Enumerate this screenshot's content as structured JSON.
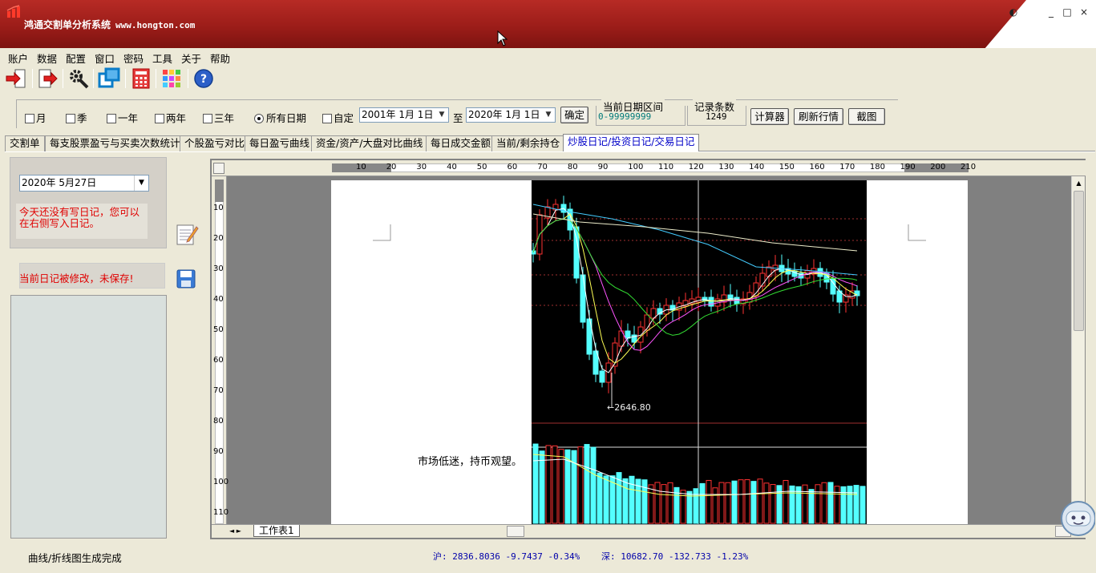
{
  "window": {
    "title": "鸿通交割单分析系统",
    "site": "www.hongton.com",
    "controls": [
      "◐",
      "_",
      "□",
      "×"
    ]
  },
  "menu": [
    "账户",
    "数据",
    "配置",
    "窗口",
    "密码",
    "工具",
    "关于",
    "帮助"
  ],
  "toolbar": [
    "login-icon",
    "logout-icon",
    "settings-tools-icon",
    "windows-icon",
    "calculator-icon",
    "color-grid-icon",
    "help-icon"
  ],
  "filters": {
    "options": [
      "月",
      "季",
      "一年",
      "两年",
      "三年"
    ],
    "all_dates": "所有日期",
    "custom": "自定",
    "from_date": "2001年 1月 1日",
    "to_label": "至",
    "to_date": "2020年 1月 1日",
    "confirm": "确定",
    "range_label": "当前日期区间",
    "range_value": "0-99999999",
    "count_label": "记录条数",
    "count_value": "1249",
    "calc_button": "计算器",
    "refresh_button": "刷新行情",
    "screenshot_button": "截图"
  },
  "tabs": [
    "交割单",
    "每支股票盈亏与买卖次数统计",
    "个股盈亏对比",
    "每日盈亏曲线",
    "资金/资产/大盘对比曲线",
    "每日成交金额",
    "当前/剩余持仓",
    "炒股日记/投资日记/交易日记"
  ],
  "active_tab": 7,
  "diary": {
    "date": "2020年 5月27日",
    "notice": "今天还没有写日记，您可以在右侧写入日记。",
    "unsaved": "当前日记被修改，未保存!"
  },
  "editor": {
    "hruler": [
      "10",
      "20",
      "30",
      "40",
      "50",
      "60",
      "70",
      "80",
      "90",
      "100",
      "110",
      "120",
      "130",
      "140",
      "150",
      "160",
      "170",
      "180",
      "190",
      "200",
      "210"
    ],
    "vruler": [
      "10",
      "20",
      "30",
      "40",
      "50",
      "60",
      "70",
      "80",
      "90",
      "100",
      "110"
    ],
    "note": "市场低迷，持币观望。",
    "low_label": "←2646.80",
    "sheet_tab": "工作表1"
  },
  "status": {
    "message": "曲线/折线图生成完成",
    "sh_quote": "沪: 2836.8036 -9.7437 -0.34%",
    "sz_quote": "深: 10682.70 -132.733 -1.23%"
  },
  "colors": {
    "title_red": "#a11f1b",
    "active_tab_text": "#0000c8",
    "warning_red": "#e00000",
    "candle_up": "#ff3232",
    "candle_down": "#54ffff"
  }
}
